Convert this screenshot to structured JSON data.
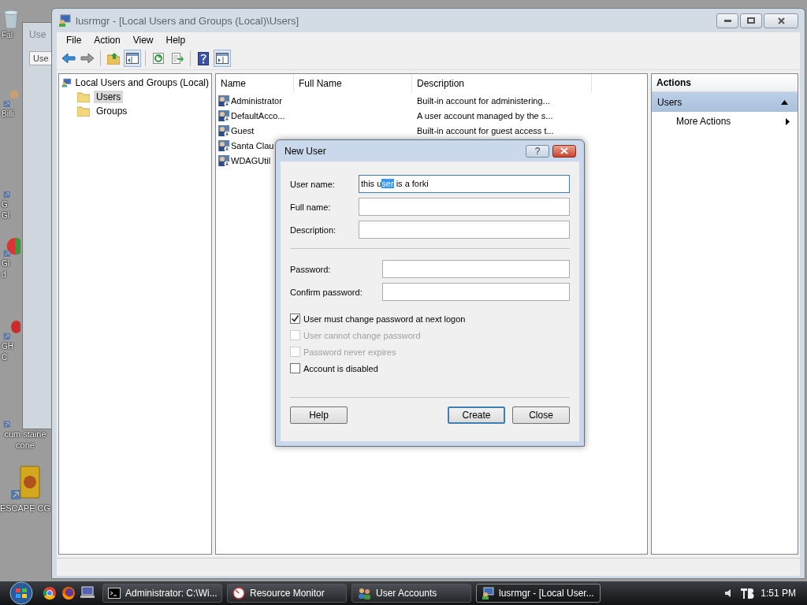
{
  "desktop": {
    "icons": [
      {
        "lines": [
          "Fal"
        ],
        "kind": "bin"
      },
      {
        "lines": [
          "Billi"
        ],
        "kind": "doc"
      },
      {
        "lines": [
          "G",
          "Gl"
        ],
        "kind": "blank"
      },
      {
        "lines": [
          "Gl",
          "d"
        ],
        "kind": "chart"
      },
      {
        "lines": [
          "GH",
          "C"
        ],
        "kind": "red"
      },
      {
        "lines": [
          "cum staine",
          "cone"
        ],
        "kind": "blank"
      },
      {
        "lines": [
          "ESCAPE CG"
        ],
        "kind": "box"
      }
    ]
  },
  "background_window": {
    "title": "Use",
    "tab": "Use"
  },
  "window": {
    "title": "lusrmgr - [Local Users and Groups (Local)\\Users]",
    "menu": [
      "File",
      "Action",
      "View",
      "Help"
    ],
    "toolbar": [
      {
        "kind": "back",
        "pressed": false
      },
      {
        "kind": "forward",
        "pressed": false
      },
      {
        "kind": "sep"
      },
      {
        "kind": "up",
        "pressed": false
      },
      {
        "kind": "tree",
        "pressed": true
      },
      {
        "kind": "sep"
      },
      {
        "kind": "refresh",
        "pressed": false
      },
      {
        "kind": "export",
        "pressed": false
      },
      {
        "kind": "sep"
      },
      {
        "kind": "help",
        "pressed": false
      },
      {
        "kind": "actions",
        "pressed": true
      }
    ],
    "tree": {
      "label": "Local Users and Groups (Local)",
      "children": [
        {
          "label": "Users",
          "selected": true
        },
        {
          "label": "Groups",
          "selected": false
        }
      ]
    },
    "table": {
      "columns": [
        "Name",
        "Full Name",
        "Description"
      ],
      "rows": [
        {
          "name": "Administrator",
          "description": "Built-in account for administering..."
        },
        {
          "name": "DefaultAcco...",
          "description": "A user account managed by the s..."
        },
        {
          "name": "Guest",
          "description": "Built-in account for guest access t..."
        },
        {
          "name": "Santa Clau"
        },
        {
          "name": "WDAGUtil"
        }
      ]
    },
    "actions": {
      "title": "Actions",
      "sections": [
        {
          "label": "Users",
          "expanded": true,
          "items": [
            "More Actions"
          ]
        }
      ]
    }
  },
  "dialog": {
    "title": "New User",
    "help_glyph": "?",
    "account_fields": [
      {
        "label": "User name:",
        "text_before_selection": "this u",
        "selected_text": "ser",
        "text_after_selection": " is a forki",
        "focused": true
      },
      {
        "label": "Full name:",
        "focused": false
      },
      {
        "label": "Description:",
        "focused": false
      }
    ],
    "password_fields": [
      {
        "label": "Password:",
        "focused": false
      },
      {
        "label": "Confirm password:",
        "focused": false
      }
    ],
    "checkboxes": [
      {
        "label": "User must change password at next logon",
        "checked": true,
        "disabled": false
      },
      {
        "label": "User cannot change password",
        "checked": false,
        "disabled": true
      },
      {
        "label": "Password never expires",
        "checked": false,
        "disabled": true
      },
      {
        "label": "Account is disabled",
        "checked": false,
        "disabled": false
      }
    ],
    "buttons": [
      {
        "label": "Help",
        "default": false
      },
      {
        "label": "Create",
        "default": true
      },
      {
        "label": "Close",
        "default": false
      }
    ]
  },
  "taskbar": {
    "quick_launch": [
      {
        "kind": "chrome"
      },
      {
        "kind": "firefox"
      },
      {
        "kind": "computer"
      }
    ],
    "tasks": [
      {
        "label": "Administrator: C:\\Wi...",
        "kind": "console",
        "selected": false
      },
      {
        "label": "Resource Monitor",
        "kind": "monitor",
        "selected": false
      },
      {
        "label": "User Accounts",
        "kind": "users",
        "selected": false
      },
      {
        "label": "lusrmgr - [Local User...",
        "kind": "mmc",
        "selected": true
      }
    ],
    "clock": "1:51 PM"
  }
}
